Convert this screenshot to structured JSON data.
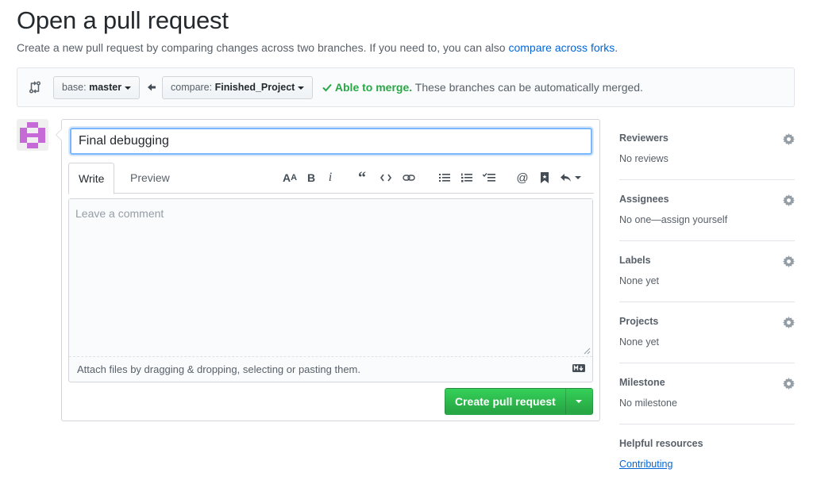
{
  "page": {
    "title": "Open a pull request",
    "description_prefix": "Create a new pull request by comparing changes across two branches. If you need to, you can also ",
    "description_link": "compare across forks",
    "description_suffix": "."
  },
  "range": {
    "base_prefix": "base:",
    "base_branch": "master",
    "compare_prefix": "compare:",
    "compare_branch": "Finished_Project",
    "merge_ok": "Able to merge.",
    "merge_detail": "These branches can be automatically merged."
  },
  "form": {
    "title_value": "Final debugging",
    "tabs": [
      "Write",
      "Preview"
    ],
    "comment_placeholder": "Leave a comment",
    "attach_text": "Attach files by dragging & dropping, selecting or pasting them.",
    "submit_label": "Create pull request"
  },
  "toolbar": {
    "icons": [
      "text-size-icon",
      "bold-icon",
      "italic-icon",
      "quote-icon",
      "code-icon",
      "link-icon",
      "bullet-list-icon",
      "numbered-list-icon",
      "task-list-icon",
      "mention-icon",
      "bookmark-icon",
      "reply-icon"
    ]
  },
  "sidebar": {
    "reviewers": {
      "heading": "Reviewers",
      "value": "No reviews"
    },
    "assignees": {
      "heading": "Assignees",
      "value": "No one—assign yourself"
    },
    "labels": {
      "heading": "Labels",
      "value": "None yet"
    },
    "projects": {
      "heading": "Projects",
      "value": "None yet"
    },
    "milestone": {
      "heading": "Milestone",
      "value": "No milestone"
    },
    "resources": {
      "heading": "Helpful resources",
      "link": "Contributing"
    }
  },
  "colors": {
    "link": "#0366d6",
    "success": "#28a745",
    "avatar": "#c56ad6"
  }
}
